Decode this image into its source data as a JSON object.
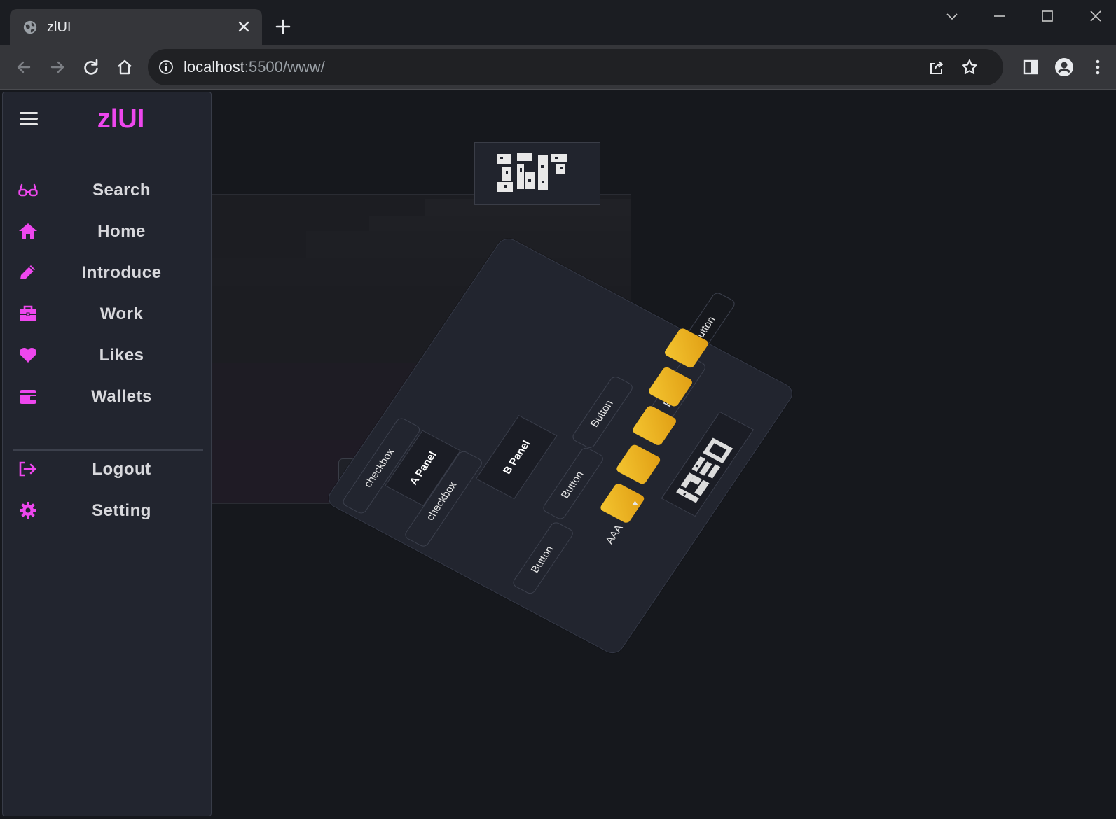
{
  "browser": {
    "tab_title": "zlUI",
    "url_host": "localhost",
    "url_rest": ":5500/www/"
  },
  "sidebar": {
    "brand": "zlUI",
    "items": [
      {
        "label": "Search",
        "icon": "glasses-icon"
      },
      {
        "label": "Home",
        "icon": "home-icon"
      },
      {
        "label": "Introduce",
        "icon": "pencil-icon"
      },
      {
        "label": "Work",
        "icon": "briefcase-icon"
      },
      {
        "label": "Likes",
        "icon": "heart-icon"
      },
      {
        "label": "Wallets",
        "icon": "wallet-icon"
      }
    ],
    "footer_items": [
      {
        "label": "Logout",
        "icon": "logout-icon"
      },
      {
        "label": "Setting",
        "icon": "gear-icon"
      }
    ]
  },
  "card": {
    "checkbox_1": "checkbox",
    "checkbox_2": "checkbox",
    "panel_a": "A Panel",
    "panel_b": "B Panel",
    "button_1": "Button",
    "button_2": "Button",
    "button_3": "Button",
    "button_4": "Button",
    "button_5": "Button",
    "select_label": "AAA"
  },
  "colors": {
    "accent": "#ee47ee",
    "gold": "#f0b421",
    "background": "#16181d",
    "sidebar": "#22252f"
  }
}
